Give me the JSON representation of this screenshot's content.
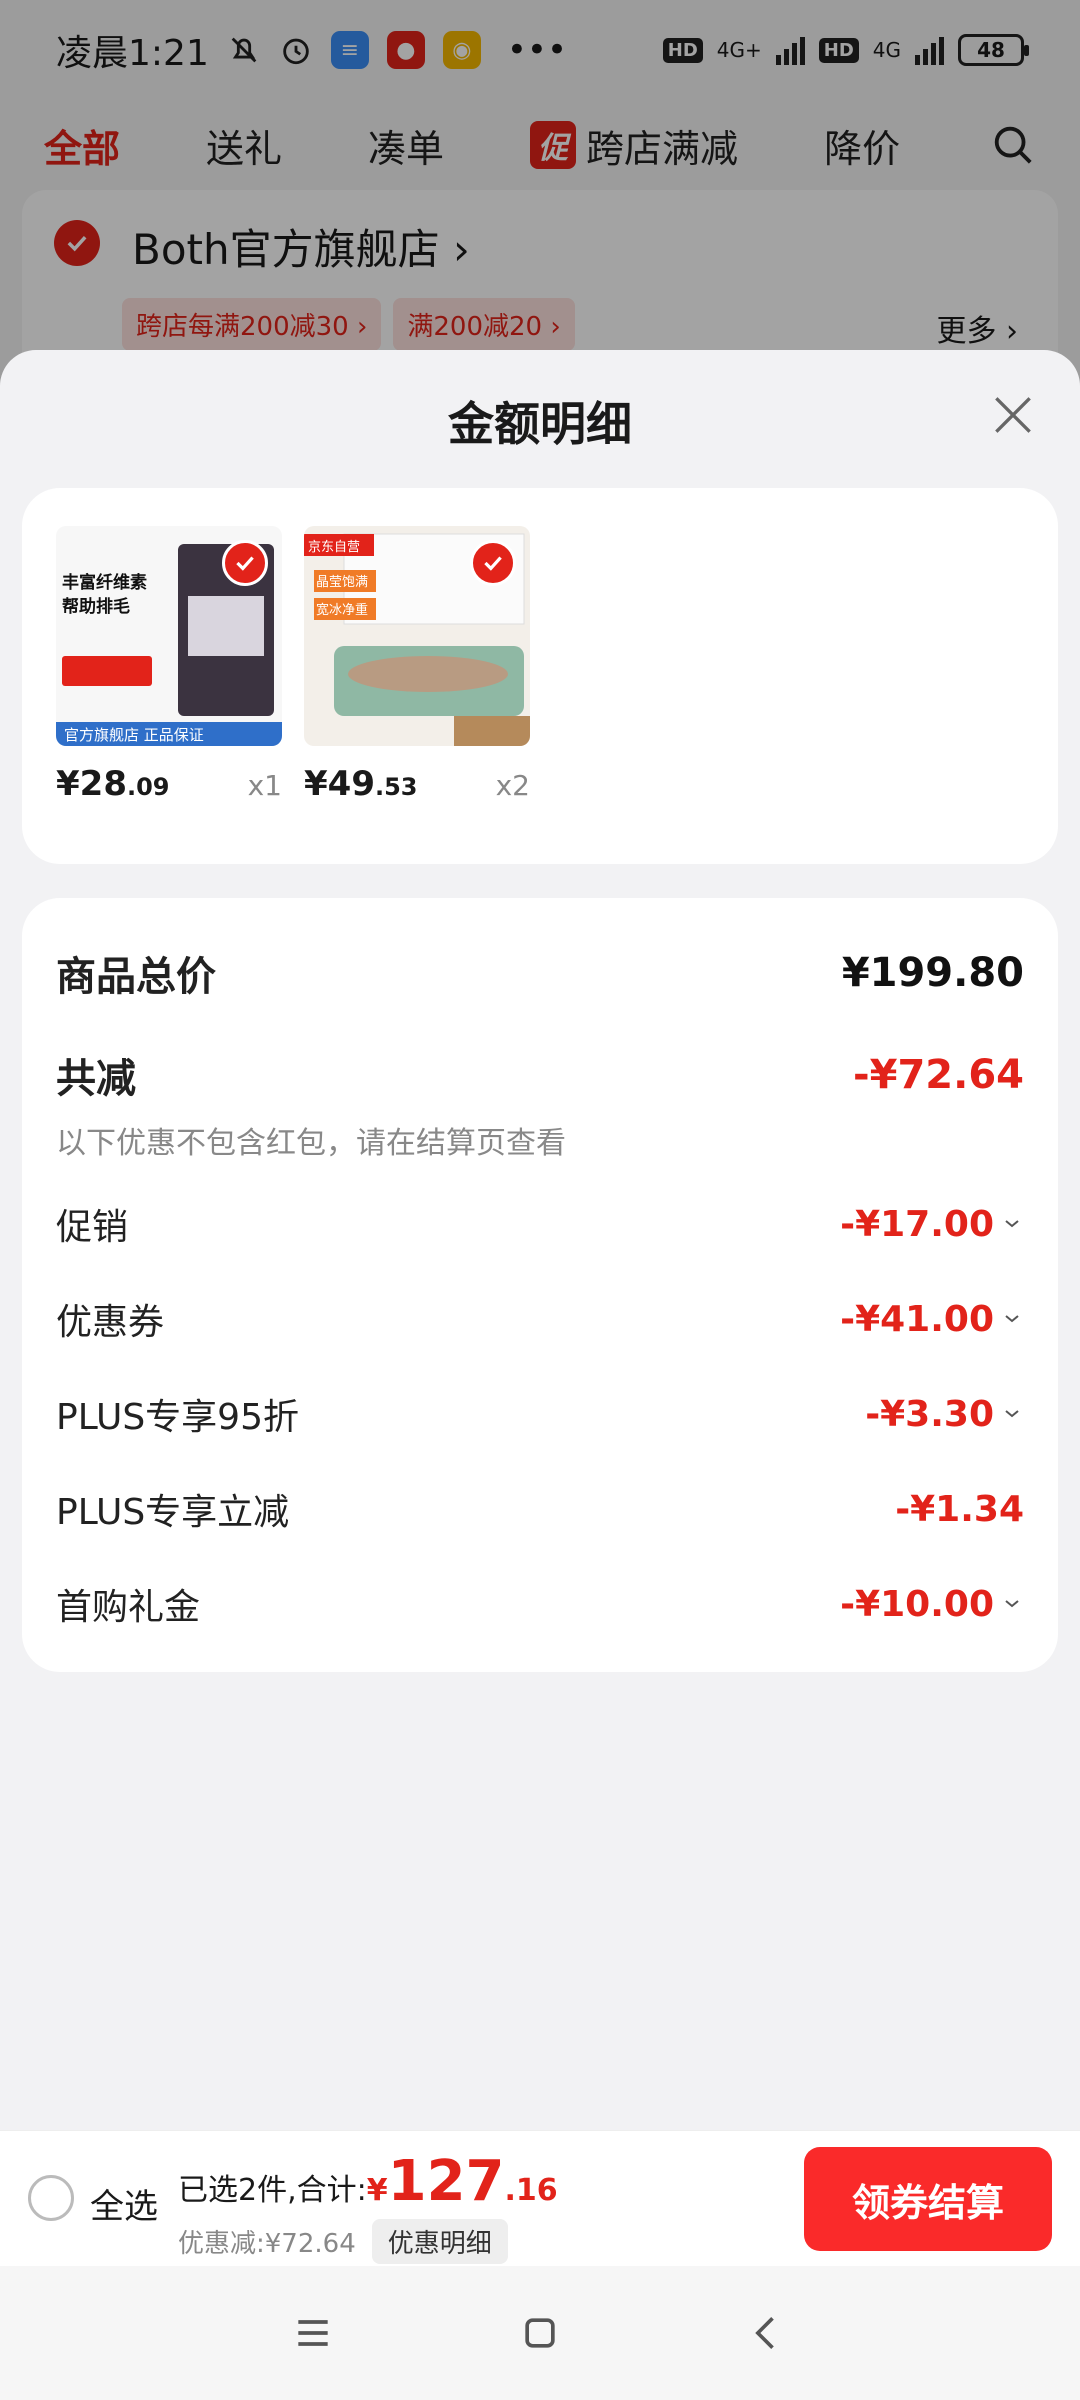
{
  "status_bar": {
    "time": "凌晨1:21",
    "dots": "•••",
    "net1": "4G+",
    "net2": "4G",
    "hd": "HD",
    "battery": "48",
    "colors": {
      "app1": "#3a8ef6",
      "app2": "#e2231a",
      "app3": "#f5b800"
    }
  },
  "tabs": {
    "items": [
      "全部",
      "送礼",
      "凑单",
      "跨店满减",
      "降价"
    ],
    "promo_badge": "促"
  },
  "store": {
    "name": "Both官方旗舰店",
    "chev": "›",
    "coupons": [
      "跨店每满200减30 ›",
      "满200减20 ›"
    ],
    "more": "更多 ›"
  },
  "sheet": {
    "title": "金额明细",
    "products": [
      {
        "price_int": "¥28",
        "price_dec": ".09",
        "qty": "x1",
        "img_text": [
          "丰富纤维素",
          "帮助排毛",
          "官方旗舰店 正品保证"
        ]
      },
      {
        "price_int": "¥49",
        "price_dec": ".53",
        "qty": "x2",
        "img_text": [
          "京东自营",
          "晶莹饱满",
          "宽冰净重"
        ]
      }
    ],
    "breakdown": {
      "total_label": "商品总价",
      "total_value": "¥199.80",
      "reduce_label": "共减",
      "reduce_value": "-¥72.64",
      "note": "以下优惠不包含红包，请在结算页查看",
      "rows": [
        {
          "label": "促销",
          "value": "-¥17.00"
        },
        {
          "label": "优惠券",
          "value": "-¥41.00"
        },
        {
          "label": "PLUS专享95折",
          "value": "-¥3.30"
        },
        {
          "label": "PLUS专享立减",
          "value": "-¥1.34"
        },
        {
          "label": "首购礼金",
          "value": "-¥10.00"
        }
      ]
    }
  },
  "bottom_bar": {
    "select_all": "全选",
    "selected_prefix": "已选2件,合计:",
    "currency": "¥",
    "total_int": "127",
    "total_dec": ".16",
    "discount_text": "优惠减:¥72.64",
    "detail_button": "优惠明细",
    "checkout_button": "领券结算"
  },
  "accent_color": "#e2231a"
}
